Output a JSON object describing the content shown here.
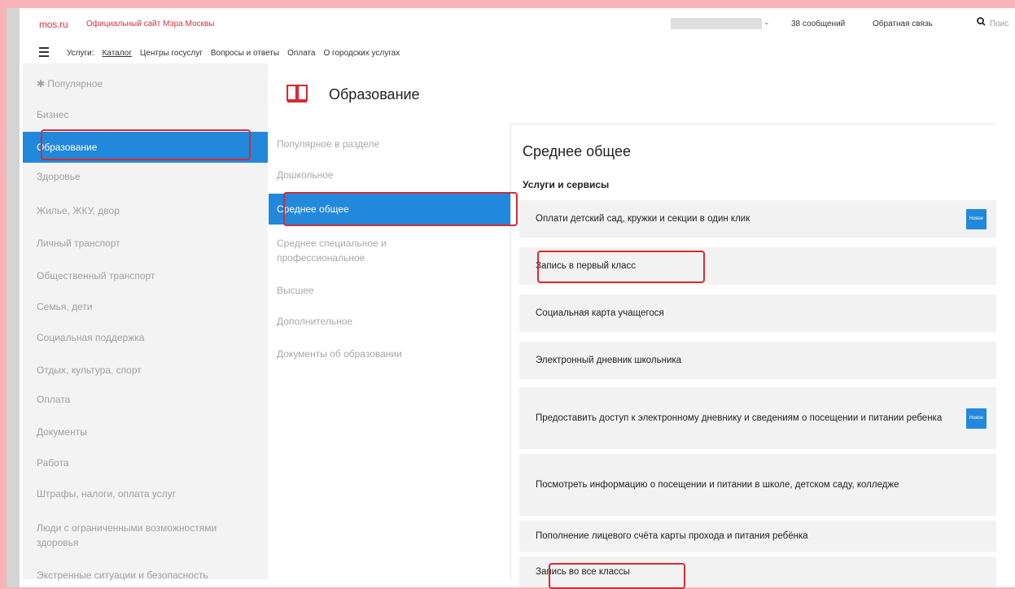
{
  "header": {
    "logo": "mos.ru",
    "site_title": "Официальный сайт Мэра Москвы",
    "messages": "38 сообщений",
    "feedback": "Обратная связь",
    "search_placeholder": "Поис"
  },
  "nav": {
    "items": [
      "Услуги:",
      "Каталог",
      "Центры госуслуг",
      "Вопросы и ответы",
      "Оплата",
      "О городских услугах"
    ],
    "active": "Каталог"
  },
  "sidebar": {
    "items": [
      "Популярное",
      "Бизнес",
      "Образование",
      "Здоровье",
      "Жилье, ЖКУ, двор",
      "Личный транспорт",
      "Общественный транспорт",
      "Семья, дети",
      "Социальная поддержка",
      "Отдых, культура, спорт",
      "Оплата",
      "Документы",
      "Работа",
      "Штрафы, налоги, оплата услуг",
      "Люди с ограниченными возможностями здоровья",
      "Экстренные ситуации и безопасность"
    ],
    "active": "Образование"
  },
  "category": {
    "title": "Образование",
    "icon": "book-icon"
  },
  "subcategories": {
    "items": [
      "Популярное в разделе",
      "Дошкольное",
      "Среднее общее",
      "Среднее специальное и профессиональное",
      "Высшее",
      "Дополнительное",
      "Документы об образовании"
    ],
    "active": "Среднее общее"
  },
  "detail": {
    "title": "Среднее общее",
    "section": "Услуги и сервисы",
    "badge_label": "Новое",
    "services": [
      "Оплати детский сад, кружки и секции в один клик",
      "Запись в первый класс",
      "Социальная карта учащегося",
      "Электронный дневник школьника",
      "Предоставить доступ к электронному дневнику и сведениям о посещении и питании ребенка",
      "Посмотреть информацию о посещении и питании в школе, детском саду, колледже",
      "Пополнение лицевого счёта карты прохода и питания ребёнка",
      "Запись во все классы"
    ]
  },
  "highlight_color": "#d42c34",
  "accent_color": "#2188dc"
}
